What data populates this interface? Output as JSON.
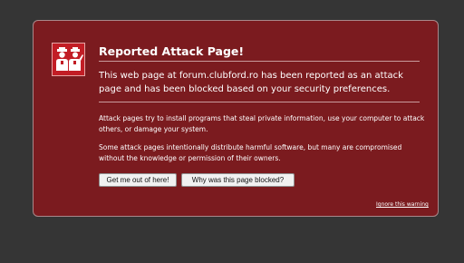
{
  "page": {
    "background_color": "#353535"
  },
  "error_panel": {
    "background_color": "#7b1b1f",
    "icon": "police-officer-shield-icon",
    "title": "Reported Attack Page!",
    "lead_text": "This web page at forum.clubford.ro has been reported as an attack page and has been blocked based on your security preferences.",
    "paragraphs": [
      "Attack pages try to install programs that steal private information, use your computer to attack others, or damage your system.",
      "Some attack pages intentionally distribute harmful software, but many are compromised without the knowledge or permission of their owners."
    ],
    "buttons": {
      "get_me_out": "Get me out of here!",
      "why_blocked": "Why was this page blocked?"
    },
    "ignore_link": "Ignore this warning"
  }
}
